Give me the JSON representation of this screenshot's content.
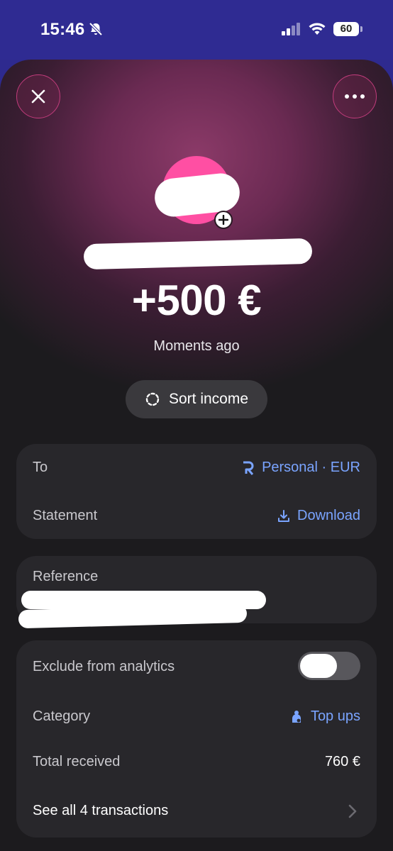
{
  "status_bar": {
    "time": "15:46",
    "battery": "60"
  },
  "header": {
    "amount": "+500 €",
    "timestamp": "Moments ago"
  },
  "sort_button": {
    "label": "Sort income"
  },
  "account_card": {
    "to_label": "To",
    "to_value": "Personal · EUR",
    "statement_label": "Statement",
    "statement_action": "Download"
  },
  "reference_card": {
    "label": "Reference"
  },
  "details_card": {
    "exclude_label": "Exclude from analytics",
    "exclude_toggle_on": false,
    "category_label": "Category",
    "category_value": "Top ups",
    "total_label": "Total received",
    "total_value": "760 €",
    "see_all_label": "See all 4 transactions"
  },
  "colors": {
    "accent": "#7aa4ff",
    "avatar": "#ff4fa3",
    "status_bar": "#2f2b92"
  }
}
